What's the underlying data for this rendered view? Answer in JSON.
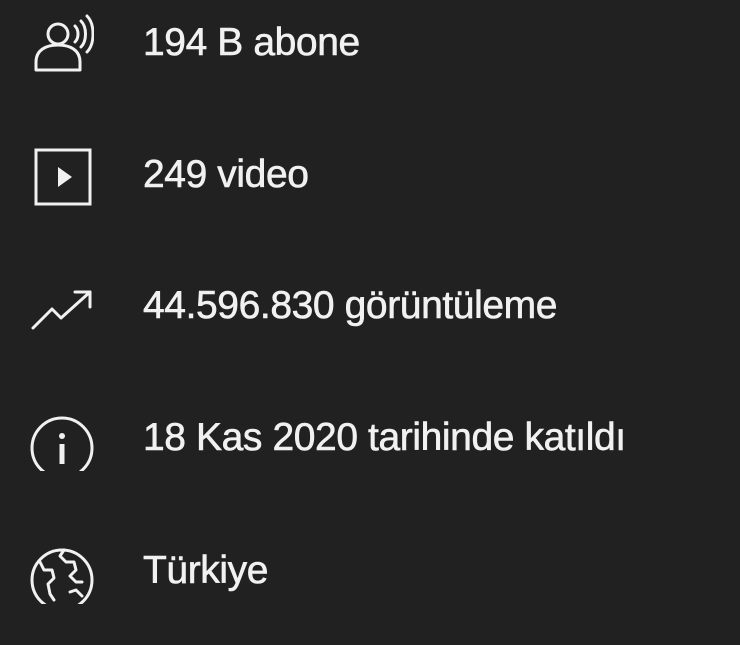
{
  "colors": {
    "background": "#212121",
    "text": "#f1f1f1",
    "icon": "#f1f1f1"
  },
  "stats": [
    {
      "icon": "subscribers-icon",
      "label": "194 B abone"
    },
    {
      "icon": "video-icon",
      "label": "249 video"
    },
    {
      "icon": "trending-up-icon",
      "label": "44.596.830 görüntüleme"
    },
    {
      "icon": "info-icon",
      "label": "18 Kas 2020 tarihinde katıldı"
    },
    {
      "icon": "globe-icon",
      "label": "Türkiye"
    }
  ]
}
